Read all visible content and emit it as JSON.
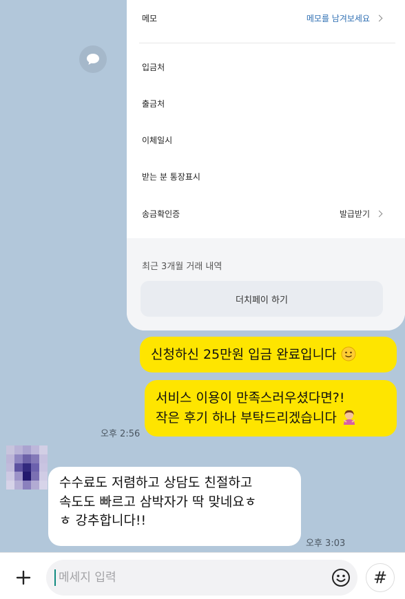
{
  "card": {
    "memo_label": "메모",
    "memo_link": "메모를 남겨보세요",
    "deposit_label": "입금처",
    "withdraw_label": "출금처",
    "transfer_date_label": "이체일시",
    "recipient_display_label": "받는 분 통장표시",
    "transfer_cert_label": "송금확인증",
    "transfer_cert_action": "발급받기",
    "recent_history": "최근 3개월 거래 내역",
    "dutch_pay_button": "더치페이 하기"
  },
  "messages": {
    "sent_1": "신청하신 25만원 입금 완료입니다",
    "sent_2_line1": "서비스 이용이 만족스러우셨다면?!",
    "sent_2_line2": "작은 후기 하나 부탁드리겠습니다",
    "sent_time": "오후 2:56",
    "received_line1": "수수료도 저렴하고 상담도 친절하고",
    "received_line2": "속도도 빠르고 삼박자가 딱 맞네요ㅎ",
    "received_line3": "ㅎ 강추합니다!!",
    "received_time": "오후 3:03"
  },
  "input": {
    "placeholder": "메세지 입력"
  },
  "icons": {
    "share": "speech-bubble-icon",
    "plus": "plus-icon",
    "emoji": "emoji-icon",
    "hash": "#"
  },
  "colors": {
    "background": "#b2c7da",
    "sent_bubble": "#fee500",
    "received_bubble": "#ffffff",
    "accent_link": "#2f6fb3"
  }
}
